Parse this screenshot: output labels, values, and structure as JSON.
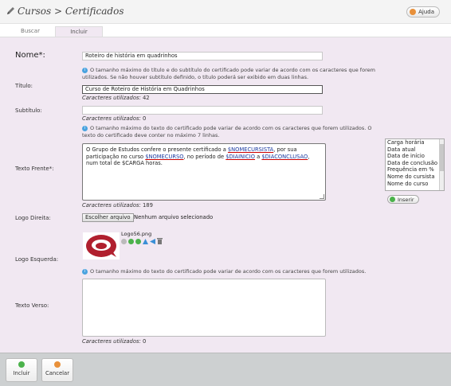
{
  "header": {
    "title": "Cursos > Certificados",
    "help_label": "Ajuda"
  },
  "tabs": [
    {
      "label": "Buscar",
      "active": false
    },
    {
      "label": "Incluir",
      "active": true
    }
  ],
  "form": {
    "nome": {
      "label": "Nome*:",
      "value": "Roteiro de história em quadrinhos"
    },
    "titulo_info": "O tamanho máximo do título e do subtítulo do certificado pode variar de acordo com os caracteres que forem utilizados. Se não houver subtítulo definido, o título poderá ser exibido em duas linhas.",
    "titulo": {
      "label": "Título:",
      "value": "Curso de Roteiro de História em Quadrinhos",
      "counter_label": "Caracteres utilizados:",
      "counter_value": "42"
    },
    "subtitulo": {
      "label": "Subtítulo:",
      "value": "",
      "counter_label": "Caracteres utilizados:",
      "counter_value": "0"
    },
    "frente_info": "O tamanho máximo do texto do certificado pode variar de acordo com os caracteres que forem utilizados. O texto do certificado deve conter no máximo 7 linhas.",
    "texto_frente": {
      "label": "Texto Frente*:",
      "parts": {
        "p1": "O Grupo de Estudos confere o presente certificado a ",
        "v1": "$NOMECURSISTA",
        "p2": ", por sua participação no curso ",
        "v2": "$NOMECURSO",
        "p3": ", no período de ",
        "v3": "$DIAINICIO",
        "p4": " a ",
        "v4": "$DIACONCLUSAO",
        "p5": ", num total de $CARGA horas."
      },
      "counter_label": "Caracteres utilizados:",
      "counter_value": "189"
    },
    "variables": [
      "Carga horária",
      "Data atual",
      "Data de início",
      "Data de conclusão",
      "Frequência em %",
      "Nome do cursista",
      "Nome do curso"
    ],
    "insert_label": "Inserir",
    "logo_direita": {
      "label": "Logo Direita:",
      "button": "Escolher arquivo",
      "status": "Nenhum arquivo selecionado"
    },
    "logo_esquerda": {
      "label": "Logo Esquerda:",
      "filename": "Logo56.png"
    },
    "verso_info": "O tamanho máximo do texto do certificado pode variar de acordo com os caracteres que forem utilizados.",
    "texto_verso": {
      "label": "Texto Verso:",
      "value": "",
      "counter_label": "Caracteres utilizados:",
      "counter_value": "0"
    }
  },
  "footer": {
    "incluir_label": "Incluir",
    "cancelar_label": "Cancelar"
  },
  "colors": {
    "panel": "#f1e8f2",
    "footer": "#cdd0d1",
    "logo_red": "#b01f2e",
    "help_orange": "#e8903a",
    "insert_green": "#4bb24b"
  }
}
